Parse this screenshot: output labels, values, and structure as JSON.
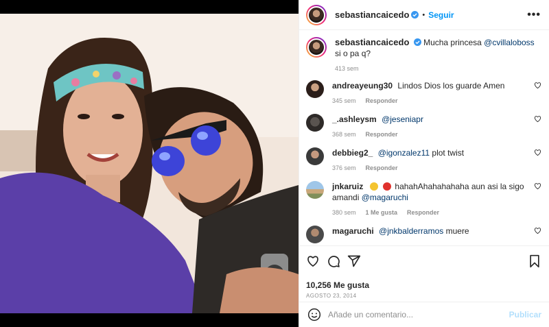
{
  "post": {
    "author": "sebastiancaicedo",
    "follow_label": "Seguir",
    "more_label": "•••",
    "caption_user": "sebastiancaicedo",
    "caption_text": "Mucha princesa",
    "caption_mention": "@cvillaloboss",
    "caption_tail": "si o pa q?",
    "caption_time": "413 sem"
  },
  "comments": [
    {
      "user": "andreayeung30",
      "text": "Lindos Dios los guarde Amen",
      "time": "345 sem",
      "reply": "Responder"
    },
    {
      "user": "_.ashleysm",
      "mention": "@jeseniapr",
      "time": "368 sem",
      "reply": "Responder"
    },
    {
      "user": "debbieg2_",
      "mention": "@igonzalez11",
      "text": "plot twist",
      "time": "376 sem",
      "reply": "Responder"
    },
    {
      "user": "jnkaruiz",
      "text": "hahahAhahahahaha aun asi la sigo amandi",
      "mention": "@magaruchi",
      "time": "380 sem",
      "likes": "1 Me gusta",
      "reply": "Responder"
    },
    {
      "user": "magaruchi",
      "mention": "@jnkbalderramos",
      "text": "muere"
    }
  ],
  "footer": {
    "likes": "10,256 Me gusta",
    "date": "AGOSTO 23, 2014",
    "add_comment_placeholder": "Añade un comentario...",
    "publish_label": "Publicar"
  },
  "colors": {
    "accent": "#0095f6",
    "mention": "#00376b",
    "muted": "#8e8e8e",
    "publish_disabled": "#b2dffc"
  }
}
